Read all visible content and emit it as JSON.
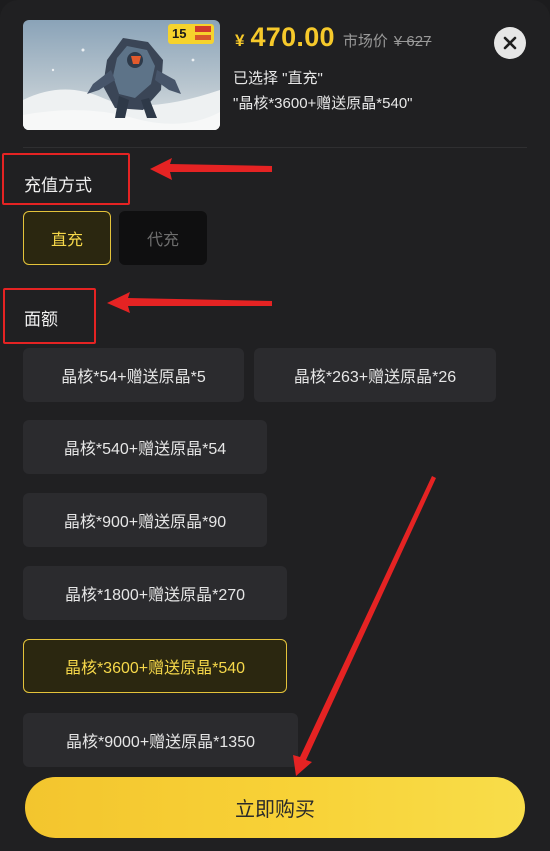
{
  "product": {
    "badge_text": "15",
    "currency_symbol": "¥",
    "price": "470.00",
    "market_label": "市场价",
    "market_price": "¥ 627",
    "selected_line": "已选择 \"直充\"",
    "selected_item": "\"晶核*3600+赠送原晶*540\""
  },
  "recharge": {
    "title": "充值方式",
    "options": [
      {
        "label": "直充",
        "selected": true
      },
      {
        "label": "代充",
        "selected": false
      }
    ]
  },
  "denomination": {
    "title": "面额",
    "options": [
      {
        "label": "晶核*54+赠送原晶*5",
        "selected": false
      },
      {
        "label": "晶核*263+赠送原晶*26",
        "selected": false
      },
      {
        "label": "晶核*540+赠送原晶*54",
        "selected": false
      },
      {
        "label": "晶核*900+赠送原晶*90",
        "selected": false
      },
      {
        "label": "晶核*1800+赠送原晶*270",
        "selected": false
      },
      {
        "label": "晶核*3600+赠送原晶*540",
        "selected": true
      },
      {
        "label": "晶核*9000+赠送原晶*1350",
        "selected": false
      }
    ]
  },
  "buy_button": {
    "label": "立即购买"
  },
  "colors": {
    "accent": "#f6c92b",
    "annotation_red": "#e52323",
    "background": "#202022"
  },
  "icons": {
    "close": "close-icon",
    "thumbnail": "game-artwork-image"
  }
}
